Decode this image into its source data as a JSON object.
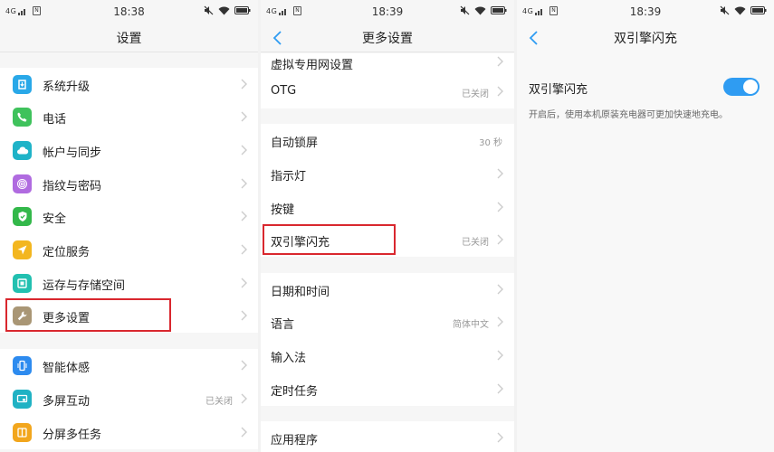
{
  "panels": [
    {
      "status": {
        "network": "4G",
        "time": "18:38"
      },
      "title": "设置",
      "items": [
        {
          "label": "系统升级",
          "icon": "system-update-icon",
          "color": "#29a8e8"
        },
        {
          "label": "电话",
          "icon": "phone-icon",
          "color": "#3fc25c"
        },
        {
          "label": "帐户与同步",
          "icon": "cloud-sync-icon",
          "color": "#1fb3c8"
        },
        {
          "label": "指纹与密码",
          "icon": "fingerprint-icon",
          "color": "#b06be0"
        },
        {
          "label": "安全",
          "icon": "shield-icon",
          "color": "#33b84a"
        },
        {
          "label": "定位服务",
          "icon": "location-icon",
          "color": "#f3b61f"
        },
        {
          "label": "运存与存储空间",
          "icon": "storage-icon",
          "color": "#22c0b0"
        },
        {
          "label": "更多设置",
          "icon": "wrench-icon",
          "color": "#a99675"
        },
        {
          "label": "智能体感",
          "icon": "motion-icon",
          "color": "#2d8bef"
        },
        {
          "label": "多屏互动",
          "icon": "multiscreen-icon",
          "color": "#20b2c4",
          "value": "已关闭"
        },
        {
          "label": "分屏多任务",
          "icon": "split-screen-icon",
          "color": "#f2a61d"
        }
      ]
    },
    {
      "status": {
        "network": "4G",
        "time": "18:39"
      },
      "title": "更多设置",
      "items": [
        {
          "label": "虚拟专用网设置"
        },
        {
          "label": "OTG",
          "value": "已关闭"
        },
        {
          "label": "自动锁屏",
          "value": "30 秒"
        },
        {
          "label": "指示灯"
        },
        {
          "label": "按键"
        },
        {
          "label": "双引擎闪充",
          "value": "已关闭"
        },
        {
          "label": "日期和时间"
        },
        {
          "label": "语言",
          "value": "简体中文"
        },
        {
          "label": "输入法"
        },
        {
          "label": "定时任务"
        },
        {
          "label": "应用程序"
        }
      ]
    },
    {
      "status": {
        "network": "4G",
        "time": "18:39"
      },
      "title": "双引擎闪充",
      "toggle_label": "双引擎闪充",
      "toggle_on": true,
      "description": "开启后，使用本机原装充电器可更加快速地充电。"
    }
  ],
  "colors": {
    "accent": "#2f9cf2",
    "highlight": "#d9272e"
  }
}
